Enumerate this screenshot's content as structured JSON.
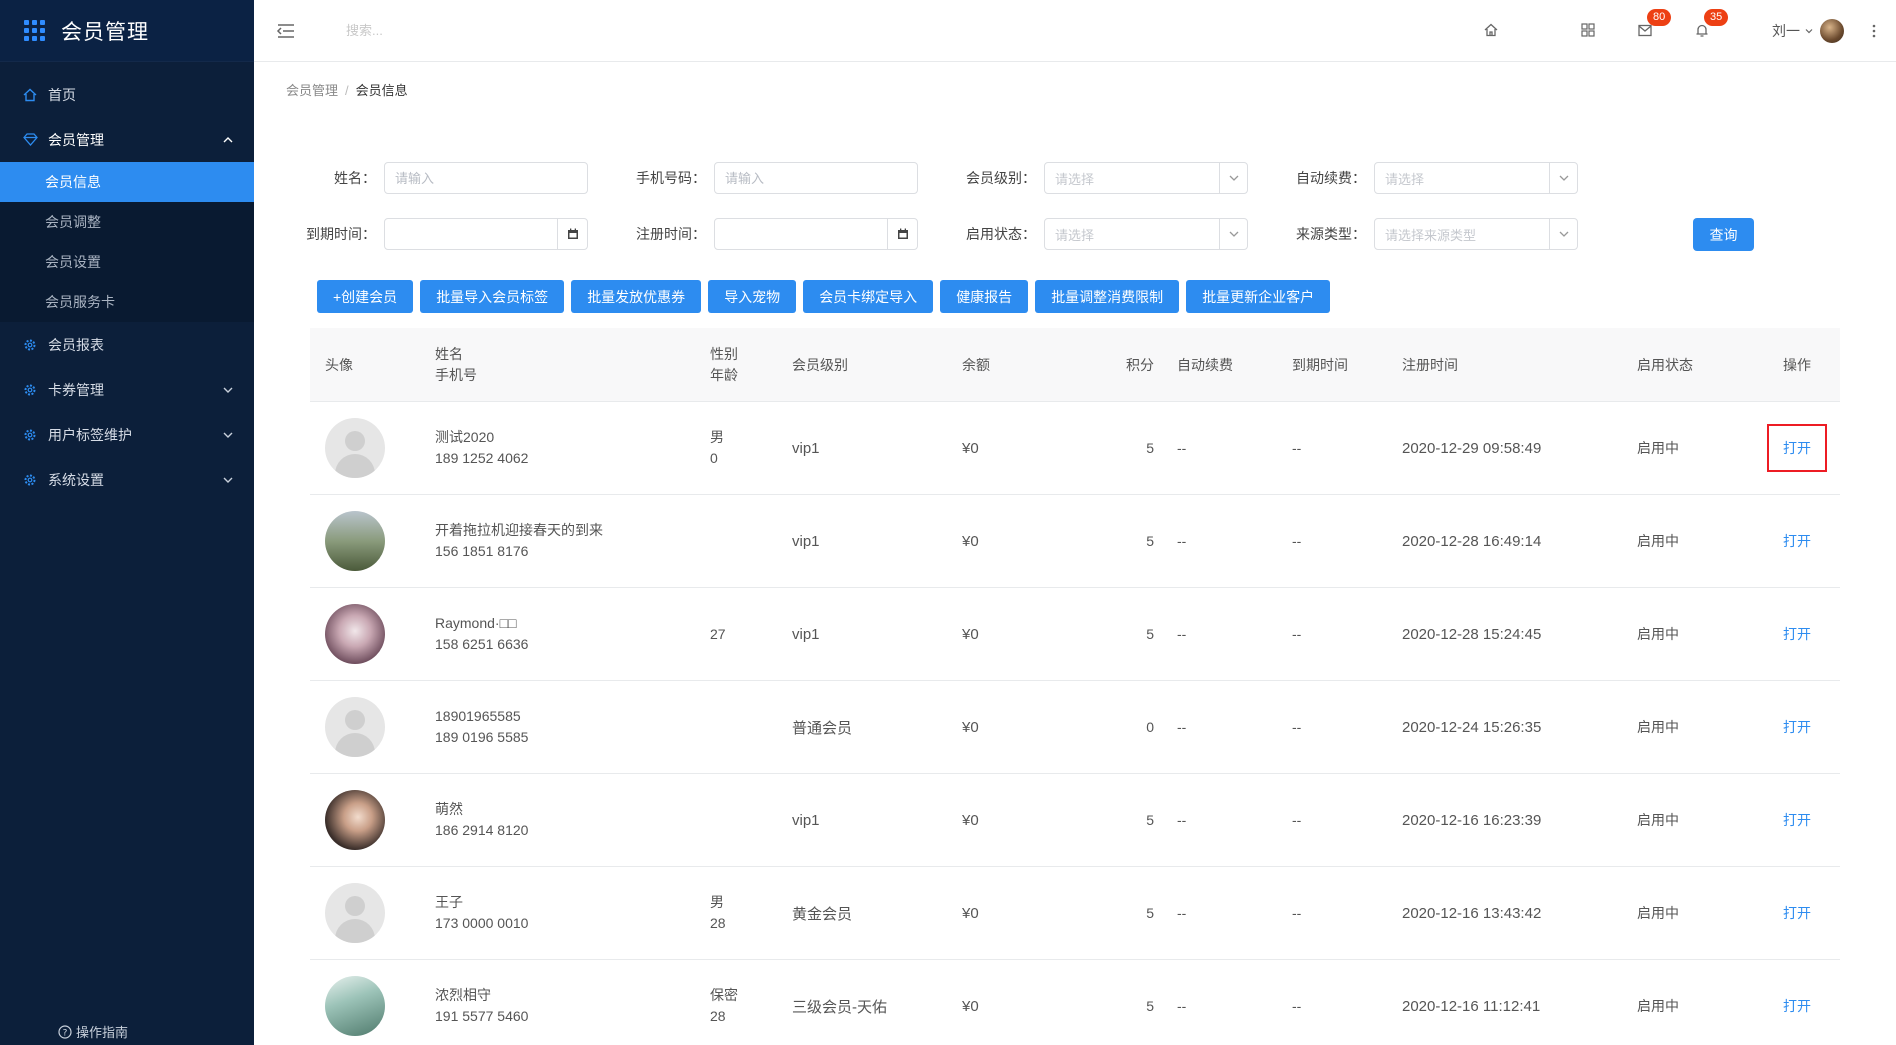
{
  "sidebar": {
    "title": "会员管理",
    "home": "首页",
    "member_mgmt": "会员管理",
    "sub": [
      "会员信息",
      "会员调整",
      "会员设置",
      "会员服务卡"
    ],
    "report": "会员报表",
    "card": "卡券管理",
    "tags": "用户标签维护",
    "system": "系统设置",
    "guide": "操作指南"
  },
  "header": {
    "search_placeholder": "搜索...",
    "mail_badge": "80",
    "bell_badge": "35",
    "user": "刘一"
  },
  "breadcrumb": {
    "root": "会员管理",
    "current": "会员信息"
  },
  "form": {
    "name_label": "姓名：",
    "name_placeholder": "请输入",
    "phone_label": "手机号码：",
    "phone_placeholder": "请输入",
    "level_label": "会员级别：",
    "level_placeholder": "请选择",
    "auto_label": "自动续费：",
    "auto_placeholder": "请选择",
    "expire_label": "到期时间：",
    "reg_label": "注册时间：",
    "status_label": "启用状态：",
    "status_placeholder": "请选择",
    "source_label": "来源类型：",
    "source_placeholder": "请选择来源类型",
    "query": "查询"
  },
  "buttons": [
    "+创建会员",
    "批量导入会员标签",
    "批量发放优惠券",
    "导入宠物",
    "会员卡绑定导入",
    "健康报告",
    "批量调整消费限制",
    "批量更新企业客户"
  ],
  "table": {
    "headers": {
      "avatar": "头像",
      "name": "姓名",
      "phone": "手机号",
      "sex": "性别",
      "age": "年龄",
      "level": "会员级别",
      "balance": "余额",
      "points": "积分",
      "auto": "自动续费",
      "expire": "到期时间",
      "reg": "注册时间",
      "status": "启用状态",
      "op": "操作"
    },
    "rows": [
      {
        "name": "测试2020",
        "phone": "189 1252 4062",
        "sex": "男",
        "age": "0",
        "level": "vip1",
        "balance": "¥0",
        "points": "5",
        "auto": "--",
        "expire": "--",
        "reg": "2020-12-29 09:58:49",
        "status": "启用中",
        "op": "打开"
      },
      {
        "name": "开着拖拉机迎接春天的到来",
        "phone": "156 1851 8176",
        "sex": "",
        "age": "",
        "level": "vip1",
        "balance": "¥0",
        "points": "5",
        "auto": "--",
        "expire": "--",
        "reg": "2020-12-28 16:49:14",
        "status": "启用中",
        "op": "打开"
      },
      {
        "name": "Raymond·□□",
        "phone": "158 6251 6636",
        "sex": "",
        "age": "27",
        "level": "vip1",
        "balance": "¥0",
        "points": "5",
        "auto": "--",
        "expire": "--",
        "reg": "2020-12-28 15:24:45",
        "status": "启用中",
        "op": "打开"
      },
      {
        "name": "18901965585",
        "phone": "189 0196 5585",
        "sex": "",
        "age": "",
        "level": "普通会员",
        "balance": "¥0",
        "points": "0",
        "auto": "--",
        "expire": "--",
        "reg": "2020-12-24 15:26:35",
        "status": "启用中",
        "op": "打开"
      },
      {
        "name": "萌然",
        "phone": "186 2914 8120",
        "sex": "",
        "age": "",
        "level": "vip1",
        "balance": "¥0",
        "points": "5",
        "auto": "--",
        "expire": "--",
        "reg": "2020-12-16 16:23:39",
        "status": "启用中",
        "op": "打开"
      },
      {
        "name": "王子",
        "phone": "173 0000 0010",
        "sex": "男",
        "age": "28",
        "level": "黄金会员",
        "balance": "¥0",
        "points": "5",
        "auto": "--",
        "expire": "--",
        "reg": "2020-12-16 13:43:42",
        "status": "启用中",
        "op": "打开"
      },
      {
        "name": "浓烈相守",
        "phone": "191 5577 5460",
        "sex": "保密",
        "age": "28",
        "level": "三级会员-天佑",
        "balance": "¥0",
        "points": "5",
        "auto": "--",
        "expire": "--",
        "reg": "2020-12-16 11:12:41",
        "status": "启用中",
        "op": "打开"
      }
    ]
  }
}
